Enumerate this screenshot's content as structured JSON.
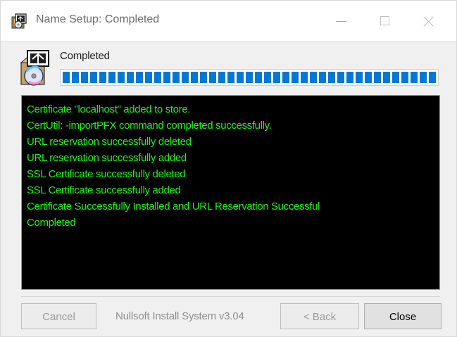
{
  "window": {
    "title": "Name Setup: Completed",
    "icons": {
      "app": "installer-app-icon",
      "minimize": "minimize-icon",
      "maximize": "maximize-icon",
      "close": "close-icon"
    }
  },
  "header": {
    "status": "Completed",
    "icon": "installer-disc-icon"
  },
  "progress": {
    "value": 1,
    "color": "#0078d7"
  },
  "log": {
    "text_color": "#21f21a",
    "background": "#000000",
    "lines": [
      "Certificate \"localhost\" added to store.",
      "CertUtil: -importPFX command completed successfully.",
      "URL reservation successfully deleted",
      "URL reservation successfully added",
      "SSL Certificate successfully deleted",
      "SSL Certificate successfully added",
      "Certificate Successfully Installed and URL Reservation Successful",
      "Completed"
    ]
  },
  "footer": {
    "branding": "Nullsoft Install System v3.04",
    "cancel_label": "Cancel",
    "back_label": "< Back",
    "close_label": "Close"
  }
}
